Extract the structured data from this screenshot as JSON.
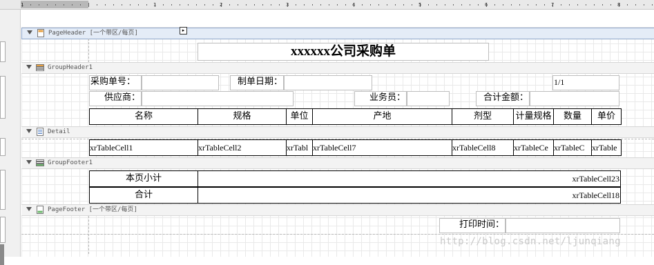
{
  "ruler": {
    "labels": [
      "1",
      "1",
      "2",
      "3",
      "4",
      "5",
      "6",
      "7",
      "8"
    ]
  },
  "bands": {
    "page_header": {
      "title": "PageHeader [一个带区/每页]",
      "smart_tag": "▸"
    },
    "group_header": {
      "title": "GroupHeader1"
    },
    "detail": {
      "title": "Detail"
    },
    "group_footer": {
      "title": "GroupFooter1"
    },
    "page_footer": {
      "title": "PageFooter [一个带区/每页]"
    }
  },
  "report": {
    "title": "xxxxxx公司采购单",
    "order_no_label": "采购单号：",
    "order_date_label": "制单日期：",
    "page_counter": "1/1",
    "supplier_label": "供应商：",
    "salesperson_label": "业务员：",
    "total_amount_label": "合计金额：",
    "columns": [
      "名称",
      "规格",
      "单位",
      "产地",
      "剂型",
      "计量规格",
      "数量",
      "单价"
    ],
    "detail_cells": [
      "xrTableCell1",
      "xrTableCell2",
      "xrTabl",
      "xrTableCell7",
      "xrTableCell8",
      "xrTableCe",
      "xrTableC",
      "xrTable"
    ],
    "page_subtotal_label": "本页小计",
    "page_subtotal_value": "xrTableCell23",
    "total_label": "合计",
    "total_value": "xrTableCell18",
    "print_time_label": "打印时间："
  },
  "watermark": "http://blog.csdn.net/ljunqiang"
}
